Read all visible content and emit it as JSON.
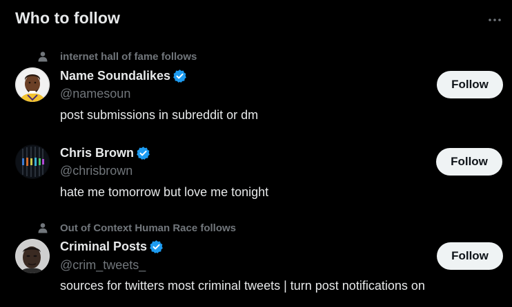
{
  "header": {
    "title": "Who to follow",
    "more_icon": "more-horizontal-icon"
  },
  "suggestions": [
    {
      "social_context": "internet hall of fame follows",
      "display_name": "Name Soundalikes",
      "verified": true,
      "handle": "@namesoun",
      "bio": "post submissions in subreddit or dm",
      "follow_label": "Follow"
    },
    {
      "social_context": "",
      "display_name": "Chris Brown",
      "verified": true,
      "handle": "@chrisbrown",
      "bio": "hate me tomorrow but love me tonight",
      "follow_label": "Follow"
    },
    {
      "social_context": "Out of Context Human Race follows",
      "display_name": "Criminal Posts",
      "verified": true,
      "handle": "@crim_tweets_",
      "bio": "sources for twitters most criminal tweets | turn post notifications on",
      "follow_label": "Follow"
    }
  ],
  "colors": {
    "background": "#000000",
    "primary_text": "#e7e9ea",
    "secondary_text": "#71767b",
    "verified_blue": "#1d9bf0",
    "follow_button_bg": "#eff3f4",
    "follow_button_text": "#0f1419"
  }
}
